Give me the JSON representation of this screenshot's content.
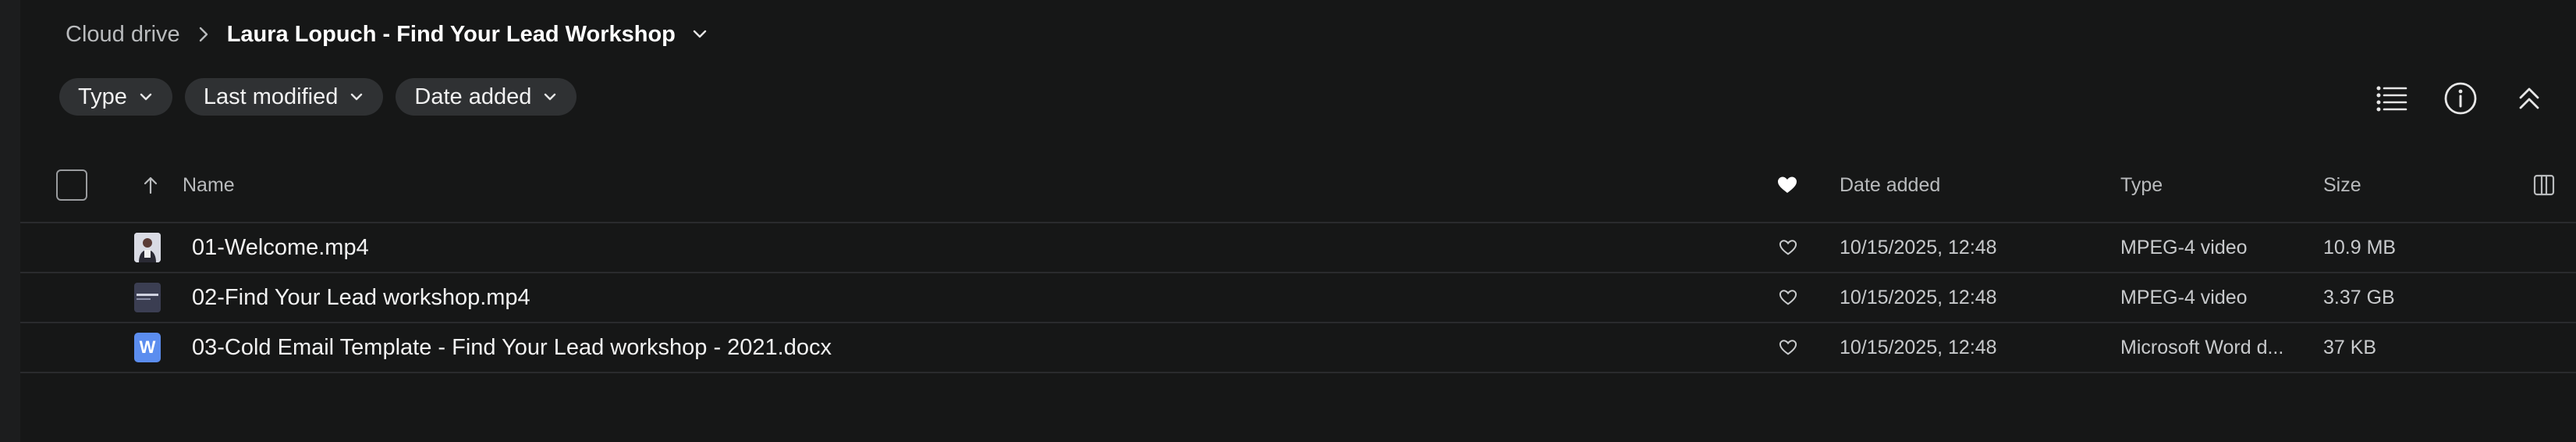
{
  "breadcrumb": {
    "root": "Cloud drive",
    "current": "Laura Lopuch - Find Your Lead Workshop"
  },
  "filters": [
    {
      "label": "Type"
    },
    {
      "label": "Last modified"
    },
    {
      "label": "Date added"
    }
  ],
  "toolbar": {
    "icons": [
      "list-view-icon",
      "info-icon",
      "collapse-icon"
    ]
  },
  "table": {
    "columns": {
      "name": "Name",
      "date_added": "Date added",
      "type": "Type",
      "size": "Size"
    },
    "rows": [
      {
        "name": "01-Welcome.mp4",
        "date_added": "10/15/2025, 12:48",
        "type": "MPEG-4 video",
        "size": "10.9 MB",
        "thumb": "video-thumbnail"
      },
      {
        "name": "02-Find Your Lead workshop.mp4",
        "date_added": "10/15/2025, 12:48",
        "type": "MPEG-4 video",
        "size": "3.37 GB",
        "thumb": "video-thumbnail"
      },
      {
        "name": "03-Cold Email Template - Find Your Lead workshop - 2021.docx",
        "date_added": "10/15/2025, 12:48",
        "type": "Microsoft Word d...",
        "size": "37 KB",
        "thumb": "word-doc-icon",
        "thumb_letter": "W"
      }
    ]
  },
  "colors": {
    "background": "#161717",
    "chip": "#2f3133",
    "word_icon": "#5b8def"
  }
}
